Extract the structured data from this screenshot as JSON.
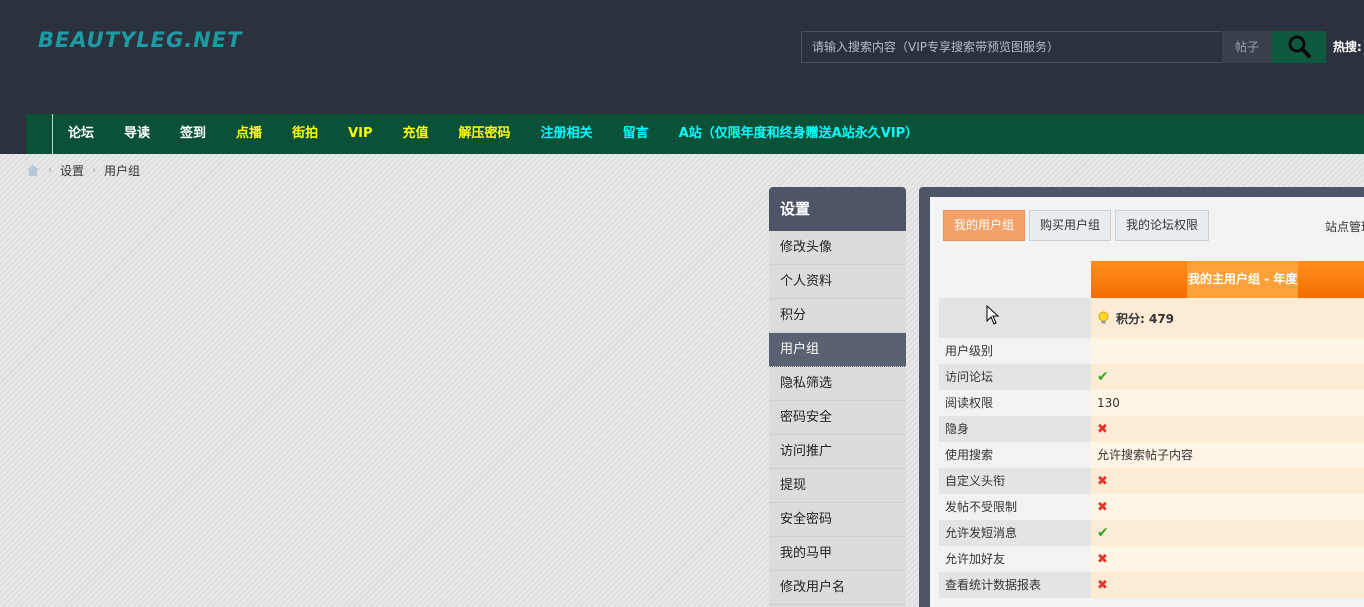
{
  "header": {
    "logo": "BEAUTYLEG.NET",
    "search_placeholder": "请输入搜索内容（VIP专享搜索带预览图服务）",
    "search_type": "帖子",
    "hot_label": "热搜:"
  },
  "nav": {
    "items": [
      {
        "label": "论坛",
        "color": "#ffffff"
      },
      {
        "label": "导读",
        "color": "#ffffff"
      },
      {
        "label": "签到",
        "color": "#ffffff"
      },
      {
        "label": "点播",
        "color": "#ffff00"
      },
      {
        "label": "街拍",
        "color": "#ffff00"
      },
      {
        "label": "VIP",
        "color": "#ffff00"
      },
      {
        "label": "充值",
        "color": "#ffff00"
      },
      {
        "label": "解压密码",
        "color": "#ffff00"
      },
      {
        "label": "注册相关",
        "color": "#00ffff"
      },
      {
        "label": "留言",
        "color": "#00ffff"
      },
      {
        "label": "A站（仅限年度和终身赠送A站永久VIP）",
        "color": "#00ffff"
      }
    ]
  },
  "breadcrumb": {
    "items": [
      "设置",
      "用户组"
    ]
  },
  "sidebar": {
    "title": "设置",
    "items": [
      {
        "label": "修改头像",
        "active": false
      },
      {
        "label": "个人资料",
        "active": false
      },
      {
        "label": "积分",
        "active": false
      },
      {
        "label": "用户组",
        "active": true
      },
      {
        "label": "隐私筛选",
        "active": false
      },
      {
        "label": "密码安全",
        "active": false
      },
      {
        "label": "访问推广",
        "active": false
      },
      {
        "label": "提现",
        "active": false
      },
      {
        "label": "安全密码",
        "active": false
      },
      {
        "label": "我的马甲",
        "active": false
      },
      {
        "label": "修改用户名",
        "active": false
      }
    ]
  },
  "main": {
    "tabs": [
      {
        "label": "我的用户组",
        "active": true
      },
      {
        "label": "购买用户组",
        "active": false
      },
      {
        "label": "我的论坛权限",
        "active": false
      }
    ],
    "site_admin": "站点管理",
    "group_header": "我的主用户组 - 年度",
    "score": "积分: 479",
    "permissions": [
      {
        "label": "用户级别",
        "value": "",
        "type": "text"
      },
      {
        "label": "访问论坛",
        "value": "✔",
        "type": "yes"
      },
      {
        "label": "阅读权限",
        "value": "130",
        "type": "text"
      },
      {
        "label": "隐身",
        "value": "✖",
        "type": "no"
      },
      {
        "label": "使用搜索",
        "value": "允许搜索帖子内容",
        "type": "text"
      },
      {
        "label": "自定义头衔",
        "value": "✖",
        "type": "no"
      },
      {
        "label": "发帖不受限制",
        "value": "✖",
        "type": "no"
      },
      {
        "label": "允许发短消息",
        "value": "✔",
        "type": "yes"
      },
      {
        "label": "允许加好友",
        "value": "✖",
        "type": "no"
      },
      {
        "label": "查看统计数据报表",
        "value": "✖",
        "type": "no"
      }
    ]
  }
}
